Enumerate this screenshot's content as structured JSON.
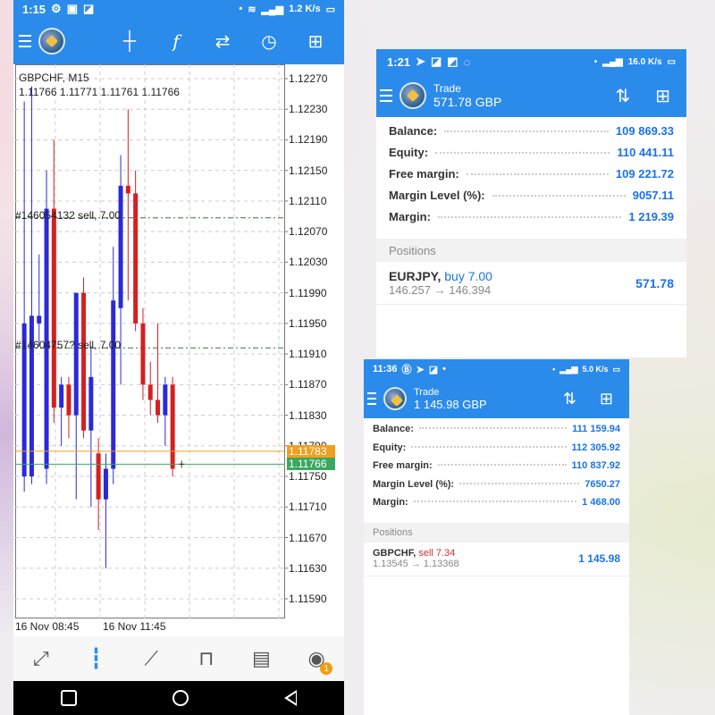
{
  "phone1": {
    "status": {
      "time": "1:15",
      "speed": "1.2 K/s"
    },
    "chart": {
      "symbol_title": "GBPCHF, M15",
      "ohlc": "1.11766 1.11771 1.11761 1.11766",
      "orders": [
        {
          "label": "#146054132 sell, 7.00",
          "price": 1.12088
        },
        {
          "label": "#14604757? sell, 7.00",
          "price": 1.11918
        }
      ],
      "price_ticks": [
        "1.12270",
        "1.12230",
        "1.12190",
        "1.12150",
        "1.12110",
        "1.12070",
        "1.12030",
        "1.11990",
        "1.11950",
        "1.11910",
        "1.11870",
        "1.11830",
        "1.11790",
        "1.11750",
        "1.11710",
        "1.11670",
        "1.11630",
        "1.11590"
      ],
      "ask_tag": "1.11783",
      "bid_tag": "1.11766",
      "time_labels": [
        "16 Nov 08:45",
        "16 Nov 11:45"
      ],
      "colors": {
        "bull": "#2a2ad8",
        "bear": "#d42020",
        "ask": "#f0a020",
        "bid": "#3aa860",
        "order_line": "#2d7a2d"
      }
    },
    "bottom_nav": [
      {
        "icon": "quotes-icon"
      },
      {
        "icon": "chart-icon"
      },
      {
        "icon": "trade-icon"
      },
      {
        "icon": "history-icon"
      },
      {
        "icon": "news-icon"
      },
      {
        "icon": "messages-icon",
        "badge": "1"
      }
    ]
  },
  "phone2": {
    "status": {
      "time": "1:21",
      "speed": "16.0 K/s"
    },
    "header": {
      "title": "Trade",
      "balance": "571.78 GBP"
    },
    "account": [
      {
        "label": "Balance:",
        "value": "109 869.33"
      },
      {
        "label": "Equity:",
        "value": "110 441.11"
      },
      {
        "label": "Free margin:",
        "value": "109 221.72"
      },
      {
        "label": "Margin Level (%):",
        "value": "9057.11"
      },
      {
        "label": "Margin:",
        "value": "1 219.39"
      }
    ],
    "positions_header": "Positions",
    "position": {
      "symbol": "EURJPY,",
      "side": "buy 7.00",
      "prices": "146.257 → 146.394",
      "profit": "571.78"
    }
  },
  "phone3": {
    "status": {
      "time": "11:36",
      "speed": "5.0 K/s"
    },
    "header": {
      "title": "Trade",
      "balance": "1 145.98 GBP"
    },
    "account": [
      {
        "label": "Balance:",
        "value": "111 159.94"
      },
      {
        "label": "Equity:",
        "value": "112 305.92"
      },
      {
        "label": "Free margin:",
        "value": "110 837.92"
      },
      {
        "label": "Margin Level (%):",
        "value": "7650.27"
      },
      {
        "label": "Margin:",
        "value": "1 468.00"
      }
    ],
    "positions_header": "Positions",
    "position": {
      "symbol": "GBPCHF,",
      "side": "sell 7.34",
      "prices": "1.13545 → 1.13368",
      "profit": "1 145.98"
    }
  },
  "chart_data": {
    "type": "candlestick",
    "title": "GBPCHF, M15",
    "ylim": [
      1.1155,
      1.1231
    ],
    "candles": [
      {
        "o": 1.1175,
        "h": 1.1224,
        "l": 1.1173,
        "c": 1.1195
      },
      {
        "o": 1.1175,
        "h": 1.1226,
        "l": 1.1174,
        "c": 1.1196
      },
      {
        "o": 1.1195,
        "h": 1.1204,
        "l": 1.1192,
        "c": 1.1196
      },
      {
        "o": 1.1176,
        "h": 1.1215,
        "l": 1.1174,
        "c": 1.121
      },
      {
        "o": 1.121,
        "h": 1.1219,
        "l": 1.1182,
        "c": 1.1184
      },
      {
        "o": 1.1184,
        "h": 1.1188,
        "l": 1.1179,
        "c": 1.1187
      },
      {
        "o": 1.1187,
        "h": 1.1188,
        "l": 1.118,
        "c": 1.1183
      },
      {
        "o": 1.1183,
        "h": 1.1193,
        "l": 1.1172,
        "c": 1.1199
      },
      {
        "o": 1.1199,
        "h": 1.1201,
        "l": 1.118,
        "c": 1.1181
      },
      {
        "o": 1.1181,
        "h": 1.1192,
        "l": 1.1171,
        "c": 1.1188
      },
      {
        "o": 1.1178,
        "h": 1.118,
        "l": 1.1168,
        "c": 1.1172
      },
      {
        "o": 1.1172,
        "h": 1.1178,
        "l": 1.1163,
        "c": 1.1176
      },
      {
        "o": 1.1176,
        "h": 1.1205,
        "l": 1.1174,
        "c": 1.1198
      },
      {
        "o": 1.1197,
        "h": 1.1217,
        "l": 1.1187,
        "c": 1.1213
      },
      {
        "o": 1.1213,
        "h": 1.1223,
        "l": 1.1198,
        "c": 1.1212
      },
      {
        "o": 1.1212,
        "h": 1.1215,
        "l": 1.1194,
        "c": 1.1195
      },
      {
        "o": 1.1195,
        "h": 1.1197,
        "l": 1.1185,
        "c": 1.1187
      },
      {
        "o": 1.1187,
        "h": 1.119,
        "l": 1.1183,
        "c": 1.1185
      },
      {
        "o": 1.1185,
        "h": 1.1195,
        "l": 1.1182,
        "c": 1.1183
      },
      {
        "o": 1.1183,
        "h": 1.1188,
        "l": 1.1179,
        "c": 1.1187
      },
      {
        "o": 1.1187,
        "h": 1.1188,
        "l": 1.1175,
        "c": 1.1176
      }
    ]
  }
}
